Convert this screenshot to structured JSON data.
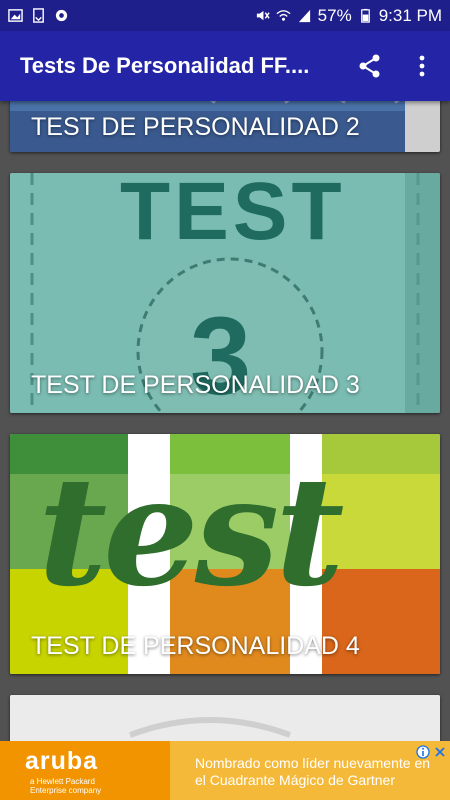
{
  "status_bar": {
    "battery": "57%",
    "time": "9:31 PM"
  },
  "app_bar": {
    "title": "Tests De Personalidad  FF...."
  },
  "cards": [
    {
      "label": "TEST DE PERSONALIDAD 2",
      "art_text": ""
    },
    {
      "label": "TEST DE PERSONALIDAD 3",
      "art_text": "TEST",
      "art_number": "3"
    },
    {
      "label": "TEST DE PERSONALIDAD 4",
      "art_text": "test"
    },
    {
      "label": ""
    }
  ],
  "ad": {
    "logo": "aruba",
    "logo_sub": "a Hewlett Packard Enterprise company",
    "message_line1": "Nombrado como líder nuevamente en",
    "message_line2": "el Cuadrante Mágico de Gartner"
  },
  "colors": {
    "status_bar": "#1f1f8c",
    "app_bar": "#2424a6",
    "card3_teal": "#7dbcb2",
    "card4_green": "#2f6e2c",
    "ad_orange": "#f29400"
  }
}
